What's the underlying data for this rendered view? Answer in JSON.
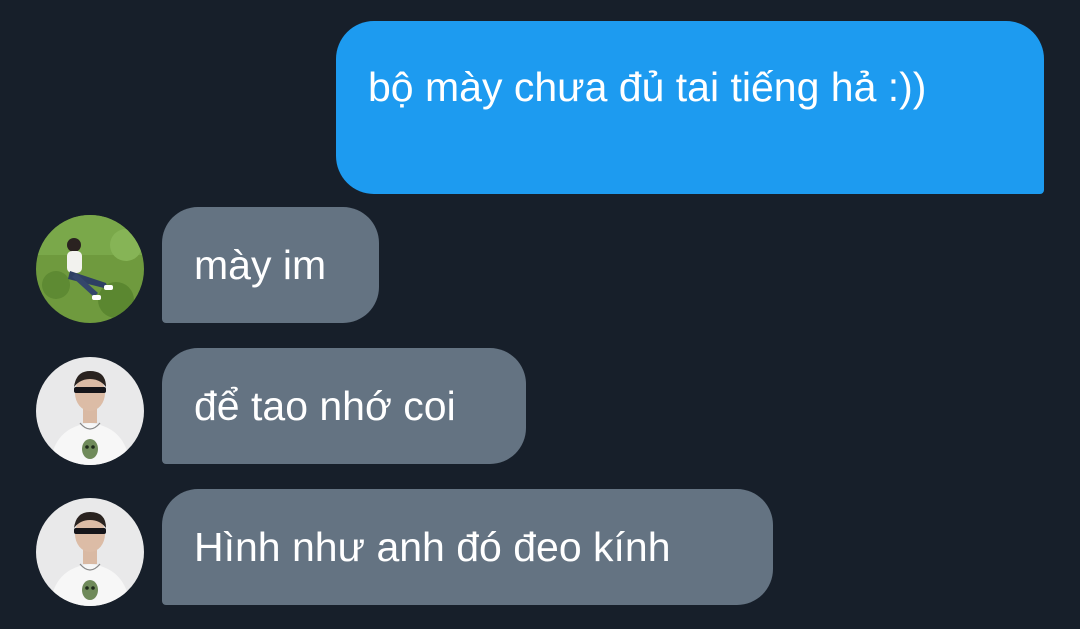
{
  "conversation": {
    "messages": [
      {
        "direction": "sent",
        "text": "bộ mày chưa đủ tai tiếng hả :))"
      },
      {
        "direction": "received",
        "text": "mày im",
        "avatar": "person-on-grass-avatar"
      },
      {
        "direction": "received",
        "text": "để tao nhớ coi",
        "avatar": "person-with-sunglasses-avatar"
      },
      {
        "direction": "received",
        "text": "Hình như anh đó đeo kính",
        "avatar": "person-with-sunglasses-avatar"
      }
    ]
  },
  "colors": {
    "background": "#171f2a",
    "sent_bubble": "#1d9bf0",
    "received_bubble": "#647382",
    "text": "#ffffff"
  }
}
